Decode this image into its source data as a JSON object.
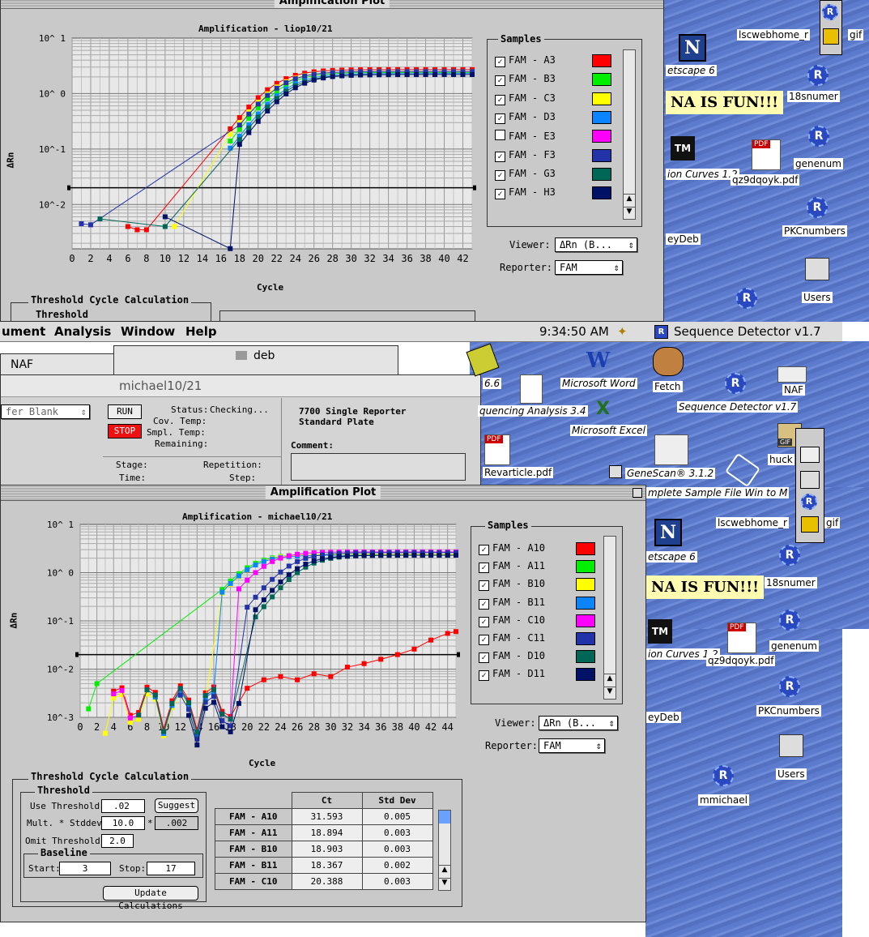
{
  "top_plot": {
    "window_title": "Amplification Plot",
    "plot_title": "Amplification - liop10/21",
    "ylabel": "ΔRn",
    "xlabel": "Cycle",
    "y_ticks": [
      "10^ 1",
      "10^ 0",
      "10^-1",
      "10^-2"
    ],
    "x_ticks": [
      "0",
      "2",
      "4",
      "6",
      "8",
      "10",
      "12",
      "14",
      "16",
      "18",
      "20",
      "22",
      "24",
      "26",
      "28",
      "30",
      "32",
      "34",
      "36",
      "38",
      "40",
      "42"
    ],
    "samples_title": "Samples",
    "samples": [
      {
        "label": "FAM - A3",
        "checked": true,
        "color": "#ff0000"
      },
      {
        "label": "FAM - B3",
        "checked": true,
        "color": "#00ee00"
      },
      {
        "label": "FAM - C3",
        "checked": true,
        "color": "#ffff00"
      },
      {
        "label": "FAM - D3",
        "checked": true,
        "color": "#0a84ff"
      },
      {
        "label": "FAM - E3",
        "checked": false,
        "color": "#ff00ff"
      },
      {
        "label": "FAM - F3",
        "checked": true,
        "color": "#2233aa"
      },
      {
        "label": "FAM - G3",
        "checked": true,
        "color": "#006655"
      },
      {
        "label": "FAM - H3",
        "checked": true,
        "color": "#001166"
      }
    ],
    "viewer_label": "Viewer:",
    "viewer_value": "ΔRn (B...",
    "reporter_label": "Reporter:",
    "reporter_value": "FAM",
    "tcc_title": "Threshold Cycle Calculation",
    "threshold_title": "Threshold"
  },
  "menubar": {
    "items": [
      "ument",
      "Analysis",
      "Window",
      "Help"
    ],
    "time": "9:34:50 AM",
    "app": "Sequence Detector v1.7"
  },
  "mid": {
    "naf_tab": "NAF",
    "deb_tab": "deb",
    "run_window_title": "michael10/21",
    "blank_popup": "fer Blank",
    "run_btn": "RUN",
    "stop_btn": "STOP",
    "status_label": "Status:",
    "status_value": "Checking...",
    "cov_temp": "Cov. Temp:",
    "smpl_temp": "Smpl. Temp:",
    "remaining": "Remaining:",
    "stage": "Stage:",
    "repetition": "Repetition:",
    "time": "Time:",
    "step": "Step:",
    "plate_line1": "7700 Single Reporter",
    "plate_line2": "Standard Plate",
    "comment_label": "Comment:"
  },
  "bottom_plot": {
    "window_title": "Amplification Plot",
    "plot_title": "Amplification - michael10/21",
    "ylabel": "ΔRn",
    "xlabel": "Cycle",
    "y_ticks": [
      "10^ 1",
      "10^ 0",
      "10^-1",
      "10^-2",
      "10^-3"
    ],
    "x_ticks": [
      "0",
      "2",
      "4",
      "6",
      "8",
      "10",
      "12",
      "14",
      "16",
      "18",
      "20",
      "22",
      "24",
      "26",
      "28",
      "30",
      "32",
      "34",
      "36",
      "38",
      "40",
      "42",
      "44"
    ],
    "samples_title": "Samples",
    "samples": [
      {
        "label": "FAM - A10",
        "checked": true,
        "color": "#ff0000"
      },
      {
        "label": "FAM - A11",
        "checked": true,
        "color": "#00ee00"
      },
      {
        "label": "FAM - B10",
        "checked": true,
        "color": "#ffff00"
      },
      {
        "label": "FAM - B11",
        "checked": true,
        "color": "#0a84ff"
      },
      {
        "label": "FAM - C10",
        "checked": true,
        "color": "#ff00ff"
      },
      {
        "label": "FAM - C11",
        "checked": true,
        "color": "#2233aa"
      },
      {
        "label": "FAM - D10",
        "checked": true,
        "color": "#006655"
      },
      {
        "label": "FAM - D11",
        "checked": true,
        "color": "#001166"
      }
    ],
    "viewer_label": "Viewer:",
    "viewer_value": "ΔRn (B...",
    "reporter_label": "Reporter:",
    "reporter_value": "FAM",
    "tcc_title": "Threshold Cycle Calculation",
    "threshold_title": "Threshold",
    "use_threshold_label": "Use Threshold:",
    "use_threshold_value": ".02",
    "suggest_btn": "Suggest",
    "mult_label": "Mult. * Stddev:",
    "mult_value": "10.0",
    "mult_star": "*",
    "mult_result": ".002",
    "omit_label": "Omit Threshold:",
    "omit_value": "2.0",
    "baseline_title": "Baseline",
    "start_label": "Start:",
    "start_value": "3",
    "stop_label": "Stop:",
    "stop_value": "17",
    "update_btn": "Update Calculations",
    "ct_table": {
      "headers": [
        "Ct",
        "Std Dev"
      ],
      "rows": [
        {
          "name": "FAM - A10",
          "ct": "31.593",
          "sd": "0.005"
        },
        {
          "name": "FAM - A11",
          "ct": "18.894",
          "sd": "0.003"
        },
        {
          "name": "FAM - B10",
          "ct": "18.903",
          "sd": "0.003"
        },
        {
          "name": "FAM - B11",
          "ct": "18.367",
          "sd": "0.002"
        },
        {
          "name": "FAM - C10",
          "ct": "20.388",
          "sd": "0.003"
        }
      ]
    }
  },
  "desktop": {
    "top": {
      "lscwebhome": "lscwebhome_r",
      "gif": "gif",
      "netscape": "etscape 6",
      "dna_fun": "NA IS FUN!!!",
      "n18snumer": "18snumer",
      "genenum": "genenum",
      "pdf_name": "qz9dqoyk.pdf",
      "curves": "ion Curves 1.2",
      "pkcnumbers": "PKCnumbers",
      "users": "Users",
      "eydeb": "eyDeb",
      "pdf_badge": "PDF",
      "tm": "TM",
      "photo_label": "mplete Sample File Win to M"
    },
    "mid": {
      "ver66": "6.6",
      "msword": "Microsoft Word",
      "fetch": "Fetch",
      "naf": "NAF",
      "seqanalysis": "quencing Analysis 3.4",
      "seqdetector": "Sequence Detector v1.7",
      "excel": "Microsoft Excel",
      "revarticle": "Revarticle.pdf",
      "genescan": "GeneScan® 3.1.2",
      "huck": "huck",
      "gif_badge": "GIF",
      "pdf_badge": "PDF",
      "sample_file": "mplete Sample File Win to M"
    },
    "bottom": {
      "lscwebhome": "lscwebhome_r",
      "gif": "gif",
      "netscape": "etscape 6",
      "dna_fun": "NA IS FUN!!!",
      "n18snumer": "18snumer",
      "genenum": "genenum",
      "pdf_name": "qz9dqoyk.pdf",
      "curves": "ion Curves 1.2",
      "pkcnumbers": "PKCnumbers",
      "users": "Users",
      "eydeb": "eyDeb",
      "mmichael": "mmichael",
      "pdf_badge": "PDF",
      "tm": "TM"
    }
  }
}
